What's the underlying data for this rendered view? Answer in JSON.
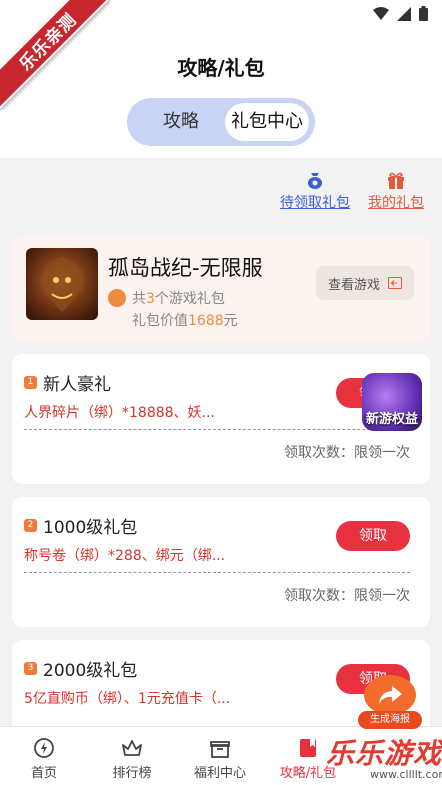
{
  "ribbon": "乐乐亲测",
  "header": {
    "title": "攻略/礼包",
    "tabs": [
      {
        "label": "攻略",
        "active": false
      },
      {
        "label": "礼包中心",
        "active": true
      }
    ]
  },
  "quick_links": {
    "pending": "待领取礼包",
    "mine": "我的礼包"
  },
  "game": {
    "name": "孤岛战纪-无限服",
    "gift_count_prefix": "共",
    "gift_count": "3",
    "gift_count_suffix": "个游戏礼包",
    "gift_value_prefix": "礼包价值",
    "gift_value": "1688",
    "gift_value_suffix": "元",
    "view_button": "查看游戏"
  },
  "packs": [
    {
      "rank": "1",
      "title": "新人豪礼",
      "items": "人界碎片（绑）*18888、妖...",
      "claim": "领取",
      "limit": "领取次数：限领一次"
    },
    {
      "rank": "2",
      "title": "1000级礼包",
      "items": "称号卷（绑）*288、绑元（绑...",
      "claim": "领取",
      "limit": "领取次数：限领一次"
    },
    {
      "rank": "3",
      "title": "2000级礼包",
      "items": "5亿直购币（绑）、1元充值卡（...",
      "claim": "领取",
      "limit": ""
    }
  ],
  "badge_newgame": "新游权益",
  "poster_button": "生成海报",
  "nav": [
    {
      "label": "首页",
      "icon": "home-icon"
    },
    {
      "label": "排行榜",
      "icon": "crown-icon"
    },
    {
      "label": "福利中心",
      "icon": "gift-box-icon"
    },
    {
      "label": "攻略/礼包",
      "icon": "book-icon"
    }
  ],
  "watermark": {
    "big": "乐乐游戏",
    "small": "www.cllllt.com"
  },
  "colors": {
    "accent": "#e8313f",
    "link_blue": "#3b5fd9",
    "highlight": "#f08a3c",
    "segment_bg": "#c9d4f5"
  }
}
